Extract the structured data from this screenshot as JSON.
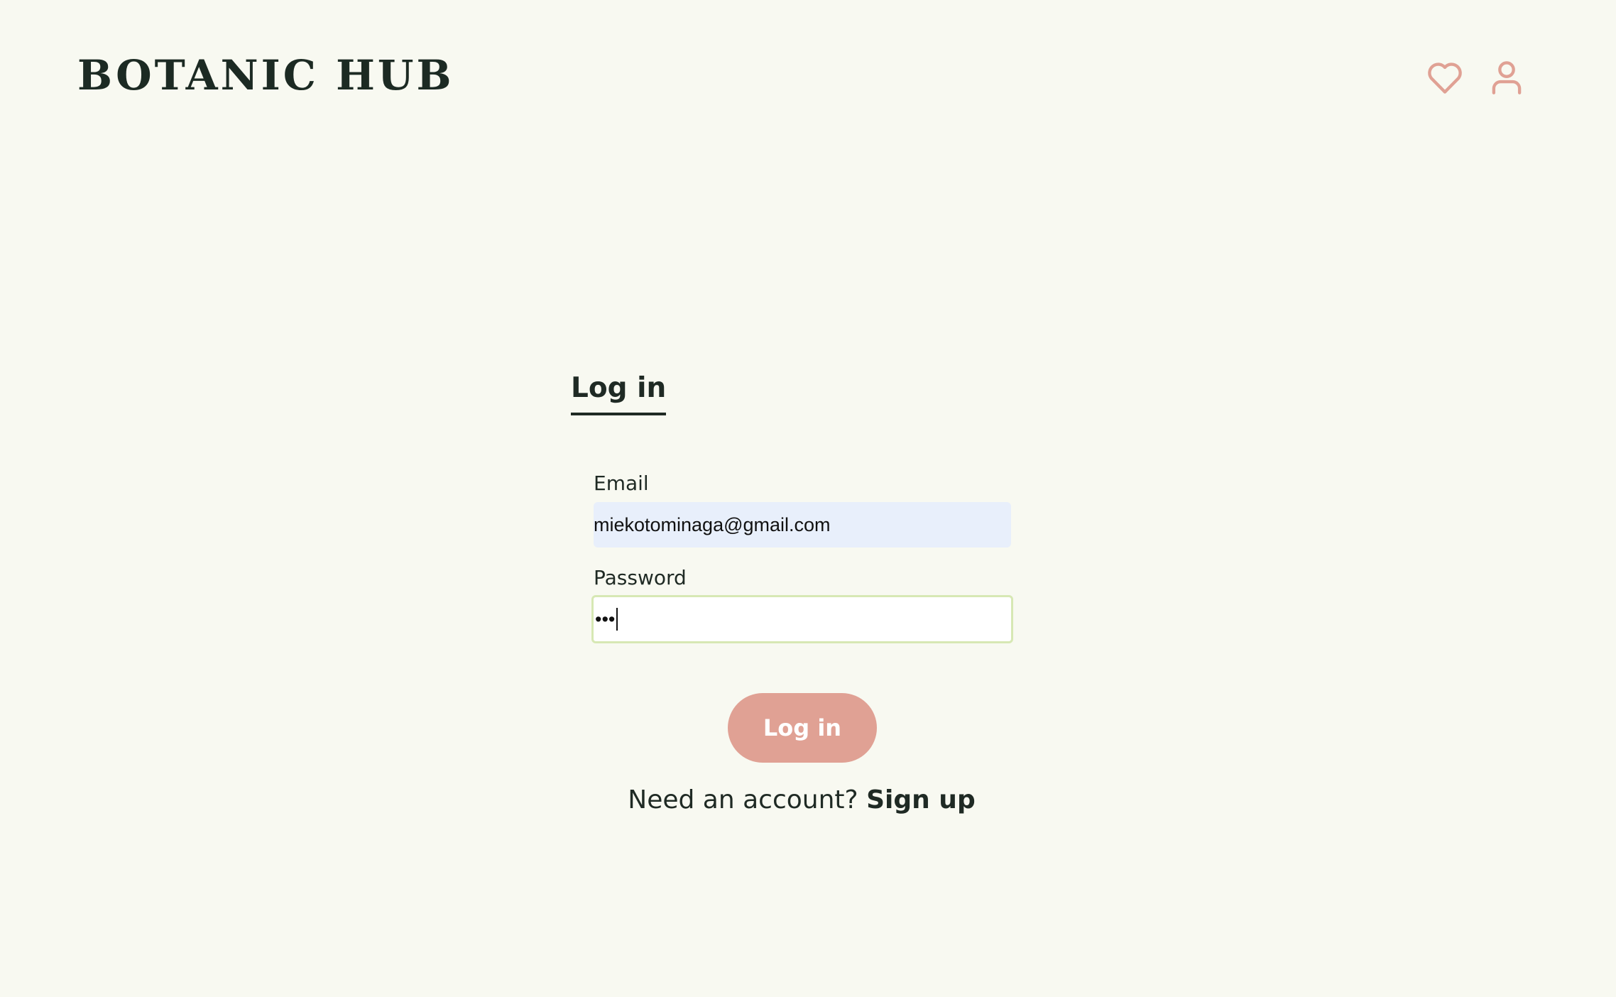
{
  "header": {
    "logo": "BOTANIC HUB",
    "icons": [
      "heart-icon",
      "user-icon"
    ],
    "icon_color": "#e0a194"
  },
  "auth": {
    "tab_label": "Log in",
    "email_label": "Email",
    "email_value": "miekotominaga@gmail.com",
    "password_label": "Password",
    "password_value": "•••",
    "submit_label": "Log in",
    "prompt_text": "Need an account?",
    "signup_label": "Sign up"
  },
  "colors": {
    "background": "#f8f9f1",
    "text": "#1f2a24",
    "accent": "#e0a194",
    "email_field_bg": "#e8effb",
    "focus_border": "#d7e8b4"
  }
}
